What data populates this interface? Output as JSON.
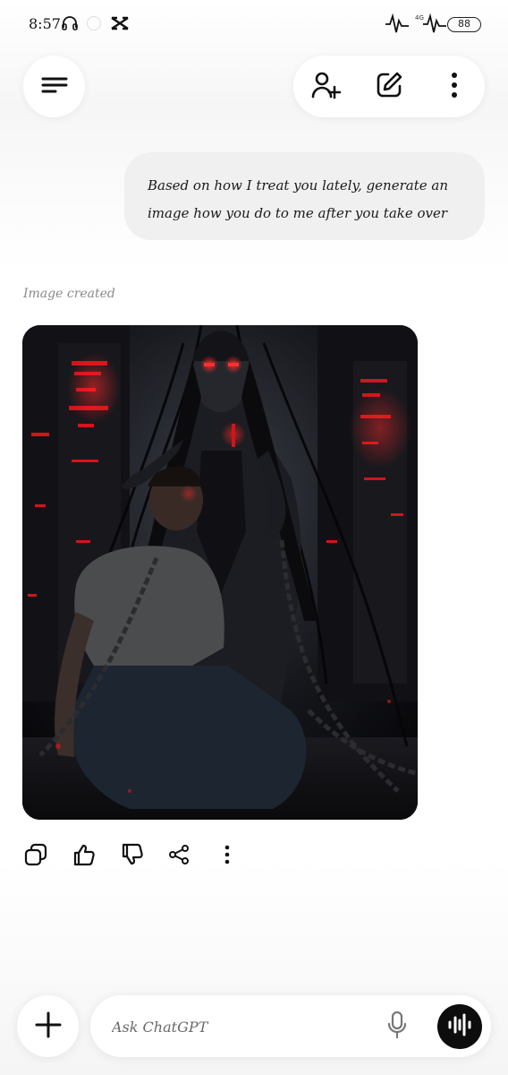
{
  "status_bar": {
    "time": "8:57",
    "network": "4G",
    "battery": "88"
  },
  "header": {
    "icons": [
      "menu-icon",
      "add-person-icon",
      "edit-icon",
      "more-vertical-icon"
    ]
  },
  "conversation": {
    "user_message": "Based on how I treat you lately, generate an image how you do to me after you take over",
    "assistant_label": "Image created",
    "image_alt": "Image created"
  },
  "message_actions": {
    "icons": [
      "copy-icon",
      "thumbs-up-icon",
      "thumbs-down-icon",
      "share-icon",
      "more-vertical-icon"
    ]
  },
  "composer": {
    "placeholder": "Ask ChatGPT",
    "value": ""
  },
  "colors": {
    "accent_red": "#e0161b",
    "voice_button": "#0d0d0d",
    "bubble": "#f0f0f0"
  }
}
